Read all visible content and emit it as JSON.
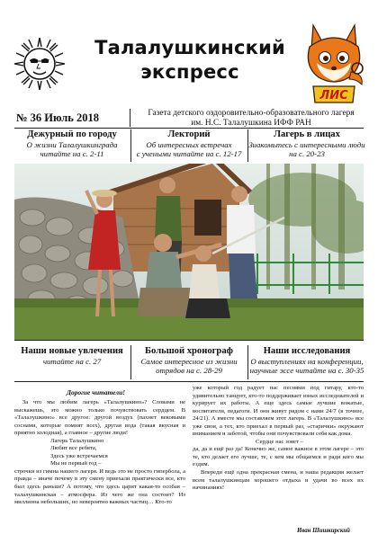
{
  "masthead": {
    "title_line1": "Талалушкинский",
    "title_line2": "экспресс",
    "fox_logo_text": "ЛИС"
  },
  "issue": {
    "number_date": "№ 36 Июль 2018",
    "publisher_line1": "Газета детского оздоровительно-образовательного лагеря",
    "publisher_line2": "им. Н.С. Талалушкина ИФФ РАН"
  },
  "teasers_top": [
    {
      "heading": "Дежурный по городу",
      "text_line1": "О жизни Талалушкинграда",
      "text_line2": "читайте на с. 2-11"
    },
    {
      "heading": "Лекторий",
      "text_line1": "Об интересных встречах",
      "text_line2": "с учеными читайте на с. 12-17"
    },
    {
      "heading": "Лагерь в лицах",
      "text_line1": "Знакомьтесь с интересными люди",
      "text_line2": "на с. 20-23"
    }
  ],
  "teasers_bottom": [
    {
      "heading": "Наши новые увлечения",
      "text_line1": "читайте на с. 27",
      "text_line2": ""
    },
    {
      "heading": "Большой хронограф",
      "text_line1": "Самое интересное из жизни",
      "text_line2": "отрядов на с. 28-29"
    },
    {
      "heading": "Наши исследования",
      "text_line1": "О выступлениях на конференции,",
      "text_line2": "научные эссе читайте на с. 30-35"
    }
  ],
  "article": {
    "greeting": "Дорогие читатели!",
    "left_p1": "За что мы любим лагерь «Талалушкино»? Словами не выскажешь, это можно только почувствовать сердцем. В «Талалушкино» все другое: другой воздух (пахнет вековыми соснами, которые помнят всех), другая вода (такая вкусная и приятно холодная), а главное – другие люди!",
    "poem_l1": "Лагерь Талалушкино",
    "poem_l2": "Любит все ребята,",
    "poem_l3": "Здесь уже встречаемся",
    "poem_l4": "Мы не первый год –",
    "left_p2": "строчки из гимна нашего лагеря. И ведь это не просто гипербола, а правда – иначе почему в эту смену приехали практически все, кто был здесь раньше? А потому, что здесь царит какая-то особая – талалушкинская – атмосфера. Из чего же она состоит? Из миллиона небольших, но невероятно важных частиц… Кто-то",
    "right_p1": "уже который год радует нас песнями под гитару, кто-то удивительно танцует, кто-то поддерживает юных исследователей и курирует их работы. А еще здесь самые лучшие вожатые, воспитатели, педагоги. И они живут рядом с нами 24/7 (в точнее, 24/21). А вместе мы составляем этот лагерь. В «Талалушкино» все уже свои, а тех, кто приехал в первый раз, «старички» окружают вниманием и заботой, чтобы они почувствовали себя как дома.",
    "poem_r1": "Сердце нас зовет –",
    "right_p2": "да, да и ещё раз да! Конечно же, самое важное в этом лагере – это те, кто делает его лучше, те, с кем мы общаемся и ради кого мы ездим.",
    "right_p3": "Впереди ещё одна прекрасная смена, и наша редакция желает всем талалушкинцам хорошего отдыха и удачи во всех их начинаниях!",
    "signature": "Иван Шишкирский"
  },
  "colors": {
    "text": "#111111",
    "rule": "#222222",
    "fox_orange": "#e8781a",
    "fox_badge": "#f4c21a",
    "photo_sky": "#dce8e6",
    "photo_grass": "#6a8a3a"
  }
}
